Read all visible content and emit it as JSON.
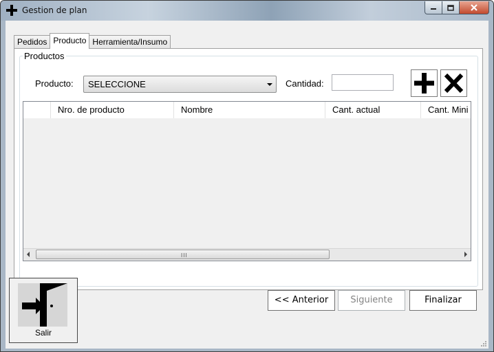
{
  "window": {
    "title": "Gestion de plan",
    "app_icon": "plus-icon"
  },
  "tabs": [
    {
      "label": "Pedidos",
      "active": false
    },
    {
      "label": "Producto",
      "active": true
    },
    {
      "label": "Herramienta/Insumo",
      "active": false
    }
  ],
  "group": {
    "title": "Productos",
    "product_label": "Producto:",
    "product_selected": "SELECCIONE",
    "quantity_label": "Cantidad:",
    "quantity_value": "",
    "add_icon": "plus-icon",
    "remove_icon": "x-icon"
  },
  "grid": {
    "columns": [
      "",
      "Nro. de producto",
      "Nombre",
      "Cant. actual",
      "Cant. Mini"
    ],
    "scroll_grip": "III"
  },
  "footer": {
    "exit_label": "Salir",
    "exit_icon": "exit-door-icon",
    "prev_label": "<< Anterior",
    "next_label": "Siguiente",
    "finish_label": "Finalizar"
  }
}
